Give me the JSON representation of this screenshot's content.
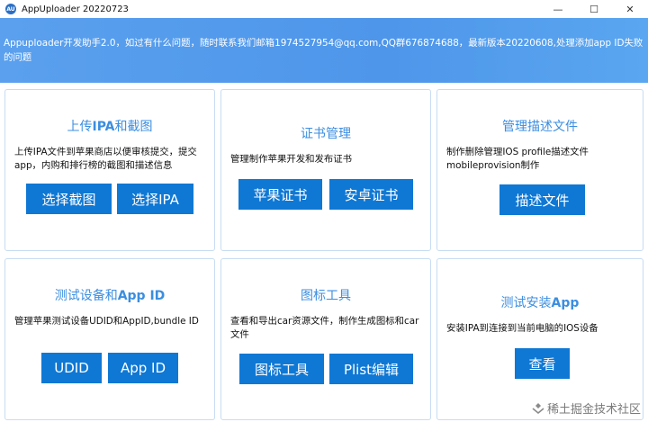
{
  "window": {
    "title": "AppUploader 20220723",
    "icon_label": "AU",
    "minimize": "—",
    "maximize": "☐",
    "close": "✕"
  },
  "banner": {
    "text": "Appuploader开发助手2.0，如过有什么问题，随时联系我们邮箱1974527954@qq.com,QQ群676874688，最新版本20220608,处理添加app ID失败的问题"
  },
  "cards": {
    "upload": {
      "title_pre": "上传",
      "title_bold": "IPA",
      "title_post": "和截图",
      "desc": "上传IPA文件到苹果商店以便审核提交，提交app，内购和排行榜的截图和描述信息",
      "btn1": "选择截图",
      "btn2": "选择IPA"
    },
    "cert": {
      "title": "证书管理",
      "desc": "管理制作苹果开发和发布证书",
      "btn1": "苹果证书",
      "btn2": "安卓证书"
    },
    "profile": {
      "title": "管理描述文件",
      "desc": "制作删除管理IOS profile描述文件mobileprovision制作",
      "btn1": "描述文件"
    },
    "device": {
      "title_pre": "测试设备和",
      "title_bold": "App ID",
      "desc": "管理苹果测试设备UDID和AppID,bundle ID",
      "btn1": "UDID",
      "btn2": "App ID"
    },
    "icon": {
      "title": "图标工具",
      "desc": "查看和导出car资源文件，制作生成图标和car文件",
      "btn1": "图标工具",
      "btn2": "Plist编辑"
    },
    "install": {
      "title_pre": "测试安装",
      "title_bold": "App",
      "desc": "安装IPA到连接到当前电脑的IOS设备",
      "btn1": "查看"
    }
  },
  "watermark": "稀土掘金技术社区",
  "colors": {
    "accent": "#0f78d4",
    "title": "#3b8ee0",
    "banner": "#5aa0ee",
    "border": "#c7dcf2"
  }
}
